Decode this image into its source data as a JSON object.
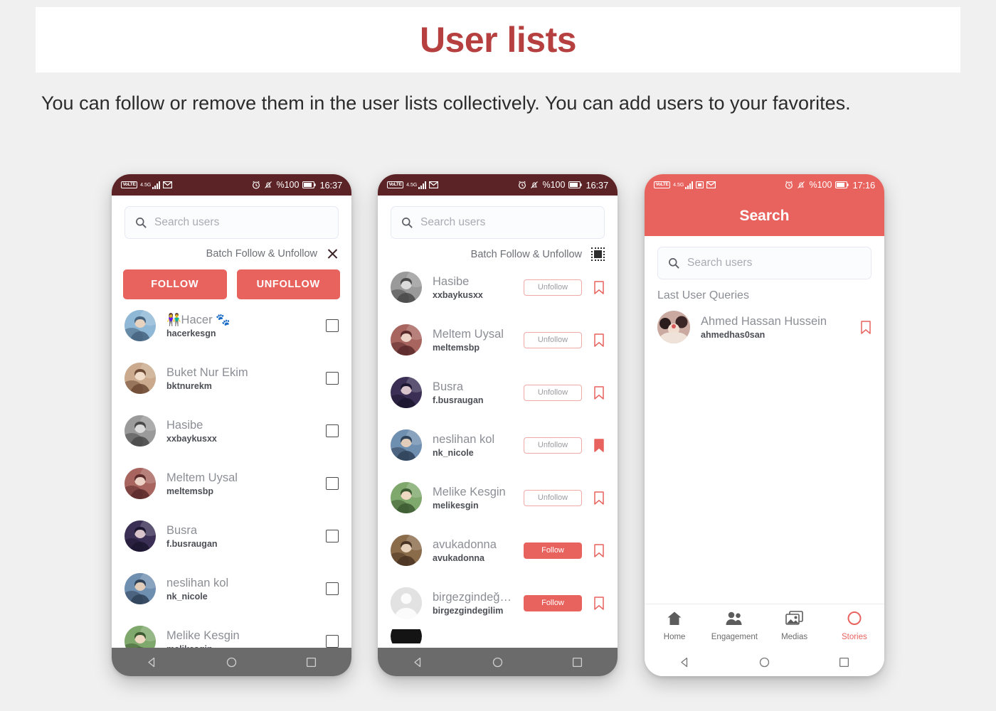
{
  "page": {
    "title": "User lists",
    "description": "You can follow or remove them in the user lists collectively. You can add users to your favorites.",
    "title_color": "#b63f3f",
    "background": "#f0f0f0"
  },
  "theme": {
    "accent": "#e8635e",
    "statusbar_dark": "#5b2326",
    "navbar_gray": "#6b6b6b"
  },
  "phone1": {
    "statusbar": {
      "volte": "VoLTE",
      "network": "4.5G",
      "mail_icon": "envelope-icon",
      "alarm_icon": "alarm-icon",
      "mute_icon": "bell-muted-icon",
      "battery_pct": "%100",
      "battery_icon": "battery-icon",
      "time": "16:37"
    },
    "search": {
      "placeholder": "Search users",
      "icon": "search-icon"
    },
    "batch": {
      "label": "Batch Follow & Unfollow",
      "icon": "close-icon"
    },
    "buttons": {
      "follow": "FOLLOW",
      "unfollow": "UNFOLLOW"
    },
    "users": [
      {
        "name": "👫Hacer 🐾",
        "handle": "hacerkesgn",
        "checked": false
      },
      {
        "name": "Buket Nur Ekim",
        "handle": "bktnurekm",
        "checked": false
      },
      {
        "name": "Hasibe",
        "handle": "xxbaykusxx",
        "checked": false
      },
      {
        "name": "Meltem Uysal",
        "handle": "meltemsbp",
        "checked": false
      },
      {
        "name": "Busra",
        "handle": "f.busraugan",
        "checked": false
      },
      {
        "name": "neslihan kol",
        "handle": "nk_nicole",
        "checked": false
      },
      {
        "name": "Melike Kesgin",
        "handle": "melikesgin",
        "checked": false
      }
    ]
  },
  "phone2": {
    "statusbar": {
      "volte": "VoLTE",
      "network": "4.5G",
      "mail_icon": "envelope-icon",
      "alarm_icon": "alarm-icon",
      "mute_icon": "bell-muted-icon",
      "battery_pct": "%100",
      "battery_icon": "battery-icon",
      "time": "16:37"
    },
    "search": {
      "placeholder": "Search users",
      "icon": "search-icon"
    },
    "batch": {
      "label": "Batch Follow & Unfollow",
      "icon": "select-all-icon"
    },
    "users": [
      {
        "name": "Hasibe",
        "handle": "xxbaykusxx",
        "action": "Unfollow",
        "action_type": "unfollow",
        "bookmarked": false
      },
      {
        "name": "Meltem Uysal",
        "handle": "meltemsbp",
        "action": "Unfollow",
        "action_type": "unfollow",
        "bookmarked": false
      },
      {
        "name": "Busra",
        "handle": "f.busraugan",
        "action": "Unfollow",
        "action_type": "unfollow",
        "bookmarked": false
      },
      {
        "name": "neslihan kol",
        "handle": "nk_nicole",
        "action": "Unfollow",
        "action_type": "unfollow",
        "bookmarked": true
      },
      {
        "name": "Melike Kesgin",
        "handle": "melikesgin",
        "action": "Unfollow",
        "action_type": "unfollow",
        "bookmarked": false
      },
      {
        "name": "avukadonna",
        "handle": "avukadonna",
        "action": "Follow",
        "action_type": "follow",
        "bookmarked": false
      },
      {
        "name": "birgezgindeğilim",
        "handle": "birgezgindegilim",
        "action": "Follow",
        "action_type": "follow",
        "bookmarked": false
      }
    ]
  },
  "phone3": {
    "statusbar": {
      "volte": "VoLTE",
      "network": "4.5G",
      "screenshot_icon": "screenshot-icon",
      "mail_icon": "envelope-icon",
      "alarm_icon": "alarm-icon",
      "mute_icon": "bell-muted-icon",
      "battery_pct": "%100",
      "battery_icon": "battery-icon",
      "time": "17:16"
    },
    "header_title": "Search",
    "search": {
      "placeholder": "Search users",
      "icon": "search-icon"
    },
    "queries_title": "Last User Queries",
    "queries": [
      {
        "name": "Ahmed Hassan Hussein",
        "handle": "ahmedhas0san",
        "bookmarked": false
      }
    ],
    "tabs": [
      {
        "label": "Home",
        "icon": "home-icon",
        "active": false
      },
      {
        "label": "Engagement",
        "icon": "people-icon",
        "active": false
      },
      {
        "label": "Medias",
        "icon": "photos-icon",
        "active": false
      },
      {
        "label": "Stories",
        "icon": "circle-icon",
        "active": true
      }
    ]
  },
  "navbar": {
    "back": "back-triangle-icon",
    "home": "home-circle-icon",
    "recents": "recents-square-icon"
  }
}
